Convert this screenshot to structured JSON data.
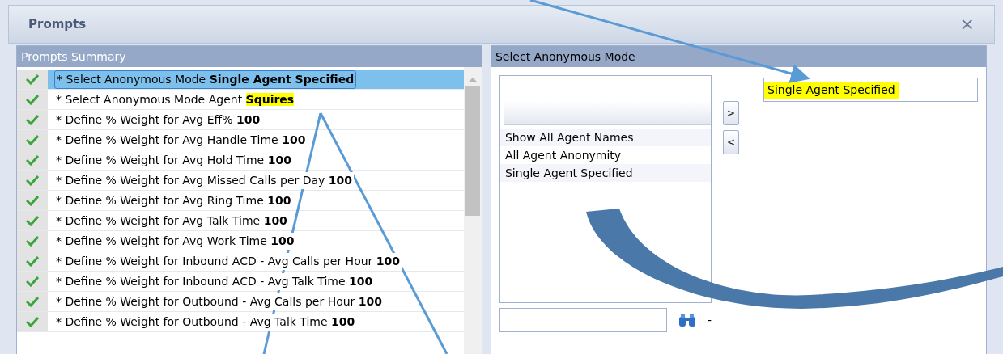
{
  "window": {
    "title": "Prompts",
    "close": "×"
  },
  "summary": {
    "title": "Prompts Summary",
    "items": [
      {
        "prompt": "* Select Anonymous Mode",
        "value": "Single Agent Specified",
        "done": true,
        "selected": true,
        "highlighted": false
      },
      {
        "prompt": "* Select Anonymous Mode Agent",
        "value": "Squires",
        "done": true,
        "selected": false,
        "highlighted": true
      },
      {
        "prompt": "* Define % Weight for Avg Eff%",
        "value": "100",
        "done": true,
        "selected": false,
        "highlighted": false
      },
      {
        "prompt": "* Define % Weight for Avg Handle Time",
        "value": "100",
        "done": true,
        "selected": false,
        "highlighted": false
      },
      {
        "prompt": "* Define % Weight for Avg Hold Time",
        "value": "100",
        "done": true,
        "selected": false,
        "highlighted": false
      },
      {
        "prompt": "* Define % Weight for Avg Missed Calls per Day",
        "value": "100",
        "done": true,
        "selected": false,
        "highlighted": false
      },
      {
        "prompt": "* Define % Weight for Avg Ring Time",
        "value": "100",
        "done": true,
        "selected": false,
        "highlighted": false
      },
      {
        "prompt": "* Define % Weight for Avg Talk Time",
        "value": "100",
        "done": true,
        "selected": false,
        "highlighted": false
      },
      {
        "prompt": "* Define % Weight for Avg Work Time",
        "value": "100",
        "done": true,
        "selected": false,
        "highlighted": false
      },
      {
        "prompt": "* Define % Weight for Inbound ACD - Avg Calls per Hour",
        "value": "100",
        "done": true,
        "selected": false,
        "highlighted": false
      },
      {
        "prompt": "* Define % Weight for Inbound ACD - Avg Talk Time",
        "value": "100",
        "done": true,
        "selected": false,
        "highlighted": false
      },
      {
        "prompt": "* Define % Weight for Outbound - Avg Calls per Hour",
        "value": "100",
        "done": true,
        "selected": false,
        "highlighted": false
      },
      {
        "prompt": "* Define % Weight for Outbound - Avg Talk Time",
        "value": "100",
        "done": true,
        "selected": false,
        "highlighted": false
      }
    ]
  },
  "mode_panel": {
    "title": "Select Anonymous Mode",
    "options": [
      {
        "label": "Show All Agent Names"
      },
      {
        "label": "All Agent Anonymity"
      },
      {
        "label": "Single Agent Specified"
      }
    ],
    "add_button": ">",
    "remove_button": "<",
    "chosen": {
      "value": "Single Agent Specified",
      "highlighted": true
    },
    "search_suffix": "-"
  }
}
